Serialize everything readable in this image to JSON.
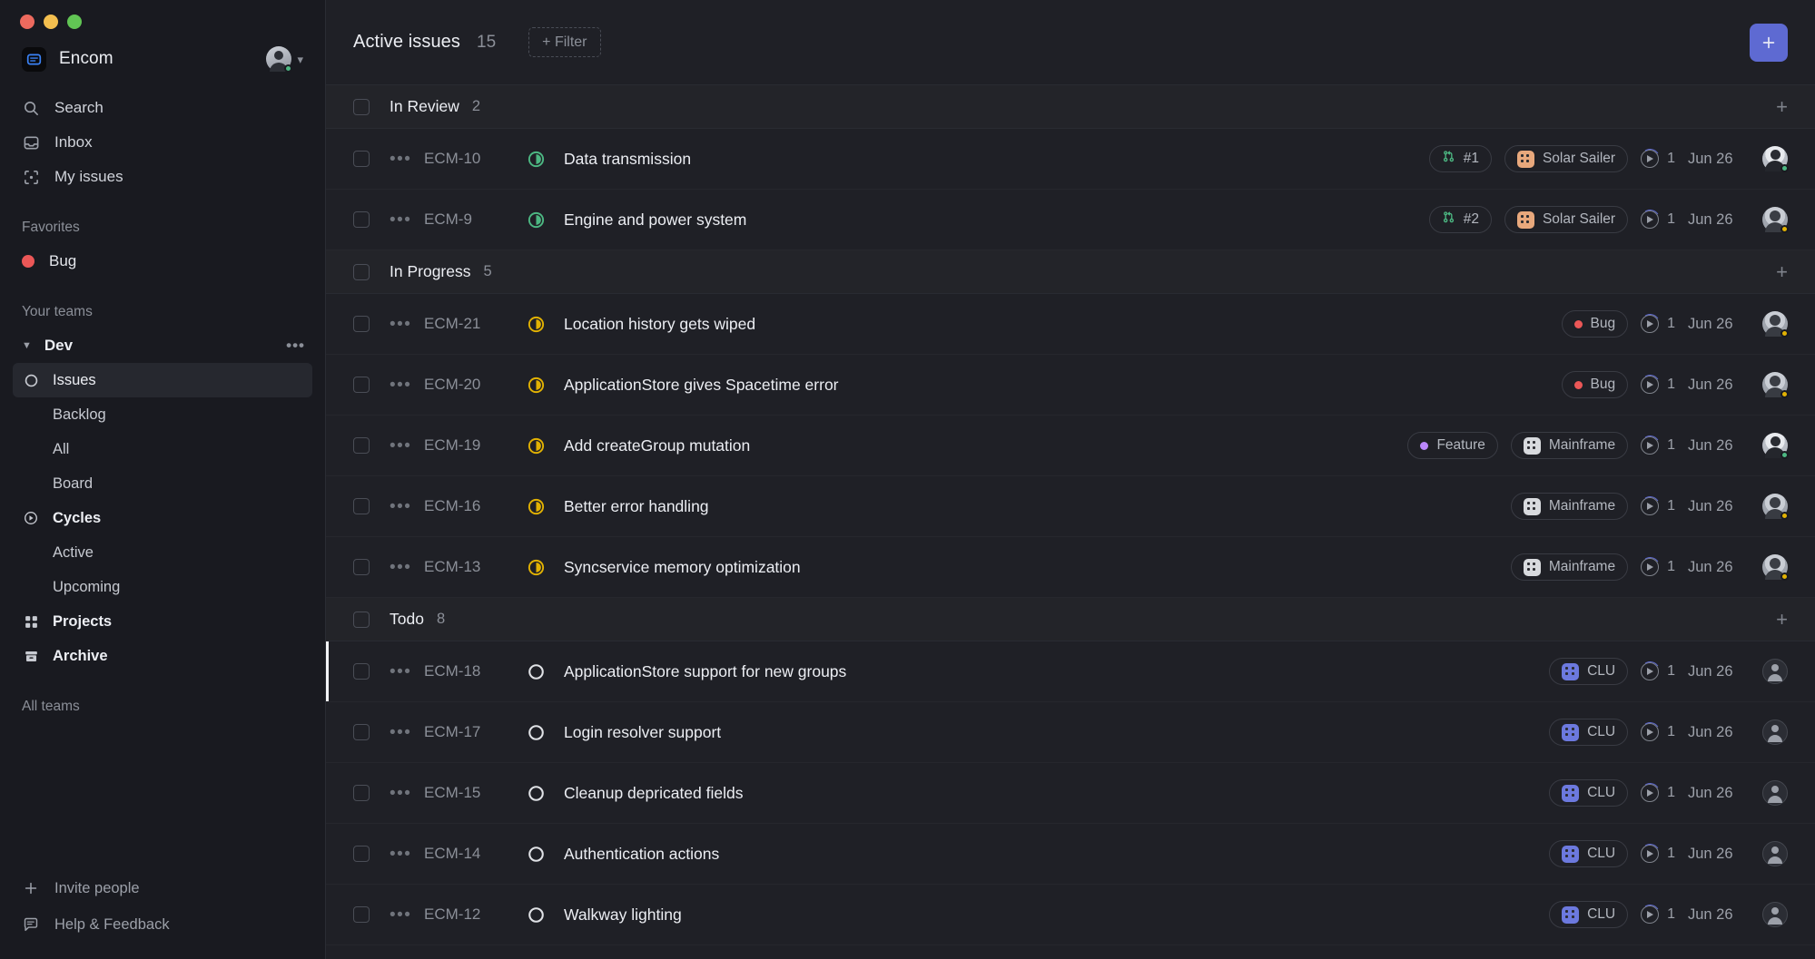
{
  "window": {
    "traffic_lights": [
      "close",
      "minimize",
      "maximize"
    ]
  },
  "sidebar": {
    "workspace": {
      "name": "Encom",
      "logo_icon": "encom-logo-icon",
      "chevron_icon": "chevron-down-icon",
      "avatar_status": "online"
    },
    "nav": [
      {
        "label": "Search",
        "icon": "search-icon"
      },
      {
        "label": "Inbox",
        "icon": "inbox-icon"
      },
      {
        "label": "My issues",
        "icon": "my-issues-icon"
      }
    ],
    "favorites_label": "Favorites",
    "favorites": [
      {
        "label": "Bug",
        "icon": "bug-dot-icon",
        "color": "#eb5757"
      }
    ],
    "your_teams_label": "Your teams",
    "team": {
      "name": "Dev",
      "caret_icon": "caret-down-icon",
      "more_icon": "ellipsis-icon"
    },
    "team_items": [
      {
        "label": "Issues",
        "icon": "circle-icon",
        "active": true,
        "indent": false,
        "strong": false
      },
      {
        "label": "Backlog",
        "icon": "",
        "active": false,
        "indent": true,
        "strong": false
      },
      {
        "label": "All",
        "icon": "",
        "active": false,
        "indent": true,
        "strong": false
      },
      {
        "label": "Board",
        "icon": "",
        "active": false,
        "indent": true,
        "strong": false
      },
      {
        "label": "Cycles",
        "icon": "cycle-icon",
        "active": false,
        "indent": false,
        "strong": true
      },
      {
        "label": "Active",
        "icon": "",
        "active": false,
        "indent": true,
        "strong": false
      },
      {
        "label": "Upcoming",
        "icon": "",
        "active": false,
        "indent": true,
        "strong": false
      },
      {
        "label": "Projects",
        "icon": "projects-icon",
        "active": false,
        "indent": false,
        "strong": true
      },
      {
        "label": "Archive",
        "icon": "archive-icon",
        "active": false,
        "indent": false,
        "strong": true
      }
    ],
    "all_teams_label": "All teams",
    "bottom": [
      {
        "label": "Invite people",
        "icon": "plus-icon"
      },
      {
        "label": "Help & Feedback",
        "icon": "chat-icon"
      }
    ]
  },
  "topbar": {
    "title": "Active issues",
    "count": "15",
    "filter_label": "+ Filter",
    "new_issue_icon": "plus-icon",
    "accent_color": "#5e6ad2"
  },
  "groups": [
    {
      "name": "In Review",
      "count": "2",
      "status": "in-review",
      "add_icon": "plus-icon",
      "issues": [
        {
          "id": "ECM-10",
          "title": "Data transmission",
          "status": "in-review",
          "branch": {
            "label": "#1",
            "icon": "git-branch-icon",
            "color": "#4cb782"
          },
          "project": {
            "label": "Solar Sailer",
            "color": "#e8a87c"
          },
          "estimate": "1",
          "date": "Jun 26",
          "assignee": {
            "type": "photo",
            "presence": "online"
          },
          "selected": false
        },
        {
          "id": "ECM-9",
          "title": "Engine and power system",
          "status": "in-review",
          "branch": {
            "label": "#2",
            "icon": "git-branch-icon",
            "color": "#4cb782"
          },
          "project": {
            "label": "Solar Sailer",
            "color": "#e8a87c"
          },
          "estimate": "1",
          "date": "Jun 26",
          "assignee": {
            "type": "photo2",
            "presence": "away"
          },
          "selected": false
        }
      ]
    },
    {
      "name": "In Progress",
      "count": "5",
      "status": "in-progress",
      "add_icon": "plus-icon",
      "issues": [
        {
          "id": "ECM-21",
          "title": "Location history gets wiped",
          "status": "in-progress",
          "label": {
            "label": "Bug",
            "color": "#eb5757"
          },
          "estimate": "1",
          "date": "Jun 26",
          "assignee": {
            "type": "photo2",
            "presence": "away"
          },
          "selected": false
        },
        {
          "id": "ECM-20",
          "title": "ApplicationStore gives Spacetime error",
          "status": "in-progress",
          "label": {
            "label": "Bug",
            "color": "#eb5757"
          },
          "estimate": "1",
          "date": "Jun 26",
          "assignee": {
            "type": "photo2",
            "presence": "away"
          },
          "selected": false
        },
        {
          "id": "ECM-19",
          "title": "Add createGroup mutation",
          "status": "in-progress",
          "label": {
            "label": "Feature",
            "color": "#bb87fc"
          },
          "project": {
            "label": "Mainframe",
            "color": "#d8dade"
          },
          "estimate": "1",
          "date": "Jun 26",
          "assignee": {
            "type": "photo",
            "presence": "online"
          },
          "selected": false
        },
        {
          "id": "ECM-16",
          "title": "Better error handling",
          "status": "in-progress",
          "project": {
            "label": "Mainframe",
            "color": "#d8dade"
          },
          "estimate": "1",
          "date": "Jun 26",
          "assignee": {
            "type": "photo2",
            "presence": "away"
          },
          "selected": false
        },
        {
          "id": "ECM-13",
          "title": "Syncservice memory optimization",
          "status": "in-progress",
          "project": {
            "label": "Mainframe",
            "color": "#d8dade"
          },
          "estimate": "1",
          "date": "Jun 26",
          "assignee": {
            "type": "photo2",
            "presence": "away"
          },
          "selected": false
        }
      ]
    },
    {
      "name": "Todo",
      "count": "8",
      "status": "todo",
      "add_icon": "plus-icon",
      "issues": [
        {
          "id": "ECM-18",
          "title": "ApplicationStore support for new groups",
          "status": "todo",
          "project": {
            "label": "CLU",
            "color": "#6c79de"
          },
          "estimate": "1",
          "date": "Jun 26",
          "assignee": {
            "type": "placeholder",
            "presence": "none"
          },
          "selected": true
        },
        {
          "id": "ECM-17",
          "title": "Login resolver support",
          "status": "todo",
          "project": {
            "label": "CLU",
            "color": "#6c79de"
          },
          "estimate": "1",
          "date": "Jun 26",
          "assignee": {
            "type": "placeholder",
            "presence": "none"
          },
          "selected": false
        },
        {
          "id": "ECM-15",
          "title": "Cleanup depricated fields",
          "status": "todo",
          "project": {
            "label": "CLU",
            "color": "#6c79de"
          },
          "estimate": "1",
          "date": "Jun 26",
          "assignee": {
            "type": "placeholder",
            "presence": "none"
          },
          "selected": false
        },
        {
          "id": "ECM-14",
          "title": "Authentication actions",
          "status": "todo",
          "project": {
            "label": "CLU",
            "color": "#6c79de"
          },
          "estimate": "1",
          "date": "Jun 26",
          "assignee": {
            "type": "placeholder",
            "presence": "none"
          },
          "selected": false
        },
        {
          "id": "ECM-12",
          "title": "Walkway lighting",
          "status": "todo",
          "project": {
            "label": "CLU",
            "color": "#6c79de"
          },
          "estimate": "1",
          "date": "Jun 26",
          "assignee": {
            "type": "placeholder",
            "presence": "none"
          },
          "selected": false
        }
      ]
    }
  ],
  "colors": {
    "bg_sidebar": "#191a20",
    "bg_main": "#1f2026",
    "bg_group_header": "#232429",
    "accent": "#5e6ad2",
    "status_in_review": "#4cb782",
    "status_in_progress": "#e2b203",
    "status_todo": "#e0e2e6"
  }
}
